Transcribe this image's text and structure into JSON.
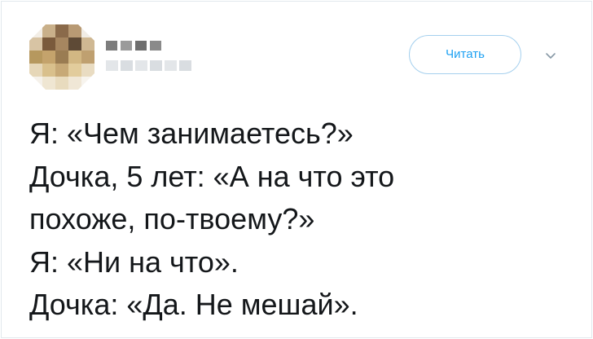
{
  "header": {
    "follow_label": "Читать",
    "caret_icon": "chevron-down-icon",
    "avatar_icon": "pixelated-avatar"
  },
  "colors": {
    "accent": "#1da1f2",
    "button_border": "#a5d0ee",
    "text": "#14171a",
    "card_border": "#e1e8ed"
  },
  "tweet": {
    "lines": [
      "Я: «Чем занимаетесь?»",
      "Дочка, 5 лет: «А на что это",
      "похоже, по-твоему?»",
      "Я: «Ни на что».",
      "Дочка: «Да. Не мешай»."
    ]
  }
}
